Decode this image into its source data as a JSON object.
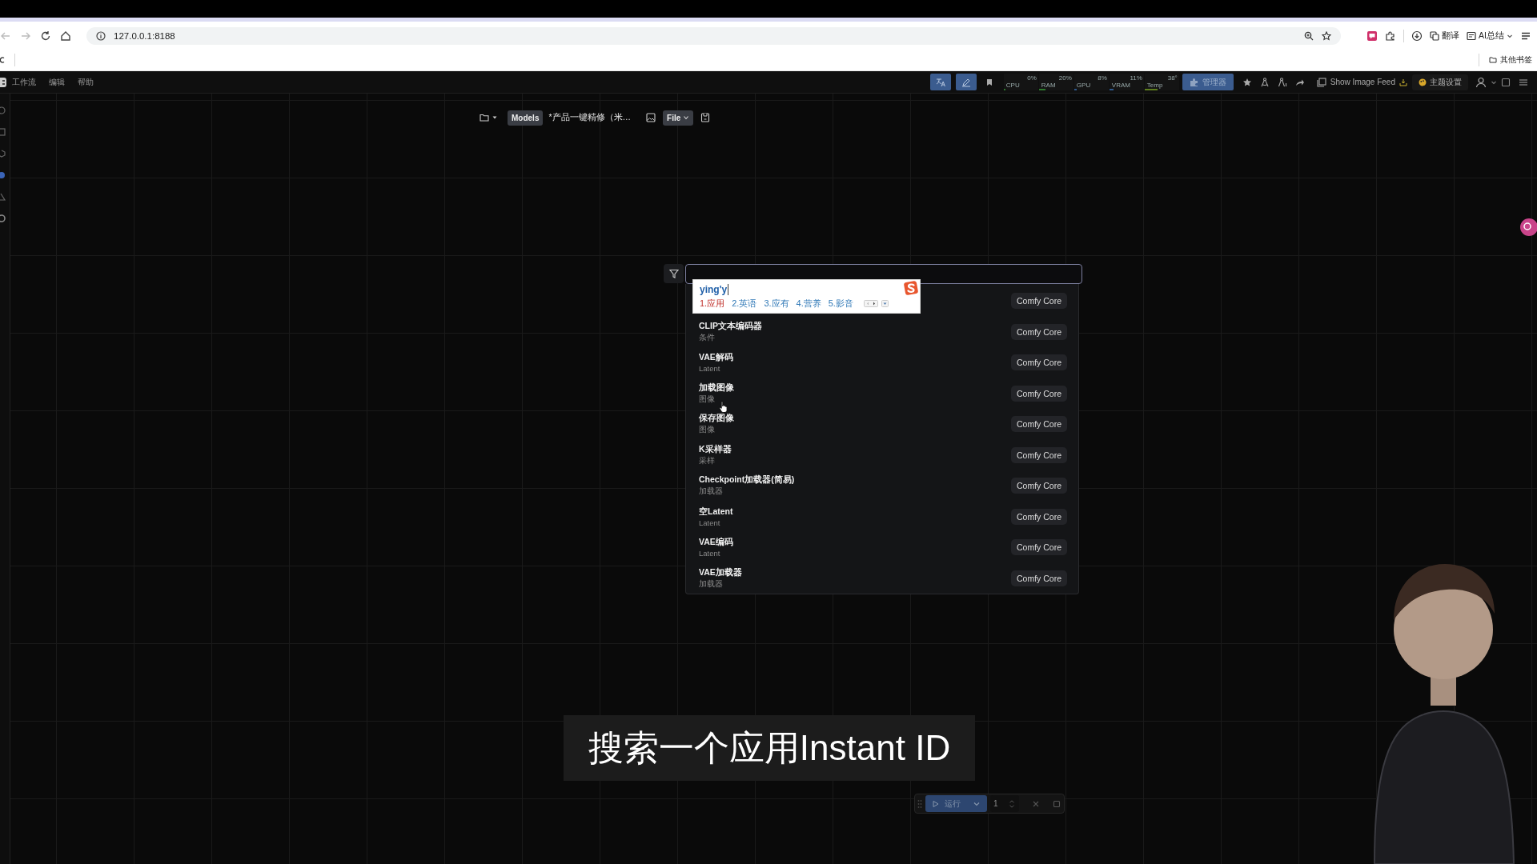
{
  "browser": {
    "address": "127.0.0.1:8188",
    "extensions": [
      {
        "label": "翻译"
      },
      {
        "label": "AI总结"
      }
    ],
    "bookmarks": [
      {
        "label": "其他书签"
      }
    ]
  },
  "menu": [
    {
      "label": "工作流"
    },
    {
      "label": "编辑"
    },
    {
      "label": "帮助"
    }
  ],
  "toolbar": {
    "toggles": [
      {
        "on": true
      },
      {
        "on": true
      }
    ],
    "monitors": [
      {
        "label": "CPU",
        "reading": "0%",
        "level": 0,
        "color": "#2f7a2f"
      },
      {
        "label": "RAM",
        "reading": "20%",
        "level": 0.2,
        "color": "#2f7a2f"
      },
      {
        "label": "GPU",
        "reading": "8%",
        "level": 0.08,
        "color": "#2f5a8f"
      },
      {
        "label": "VRAM",
        "reading": "11%",
        "level": 0.11,
        "color": "#2f5a8f"
      },
      {
        "label": "Temp",
        "reading": "38°",
        "level": 0.38,
        "color": "#5f7f1f"
      }
    ],
    "manager_button": "管理器",
    "image_feed_button": "Show Image Feed",
    "theme_button": "主题设置"
  },
  "workflow_bar": {
    "models_button": "Models",
    "title": "*产品一键精修（米…",
    "file_button": "File"
  },
  "node_search": {
    "ime": {
      "composition": "ying'y",
      "candidates": [
        {
          "label": "1.应用",
          "selected": true
        },
        {
          "label": "2.英语",
          "selected": false
        },
        {
          "label": "3.应有",
          "selected": false
        },
        {
          "label": "4.营养",
          "selected": false
        },
        {
          "label": "5.影音",
          "selected": false
        }
      ]
    },
    "results": [
      {
        "source": "Comfy Core"
      },
      {
        "name": "CLIP文本编码器",
        "category": "条件",
        "source": "Comfy Core"
      },
      {
        "name": "VAE解码",
        "category": "Latent",
        "source": "Comfy Core"
      },
      {
        "name": "加载图像",
        "category": "图像",
        "source": "Comfy Core"
      },
      {
        "name": "保存图像",
        "category": "图像",
        "source": "Comfy Core"
      },
      {
        "name": "K采样器",
        "category": "采样",
        "source": "Comfy Core"
      },
      {
        "name": "Checkpoint加载器(简易)",
        "category": "加载器",
        "source": "Comfy Core"
      },
      {
        "name": "空Latent",
        "category": "Latent",
        "source": "Comfy Core"
      },
      {
        "name": "VAE编码",
        "category": "Latent",
        "source": "Comfy Core"
      },
      {
        "name": "VAE加载器",
        "category": "加载器",
        "source": "Comfy Core"
      }
    ]
  },
  "subtitle": "搜索一个应用Instant ID",
  "run_toolbar": {
    "run_button": "运行",
    "batch_count": "1"
  }
}
